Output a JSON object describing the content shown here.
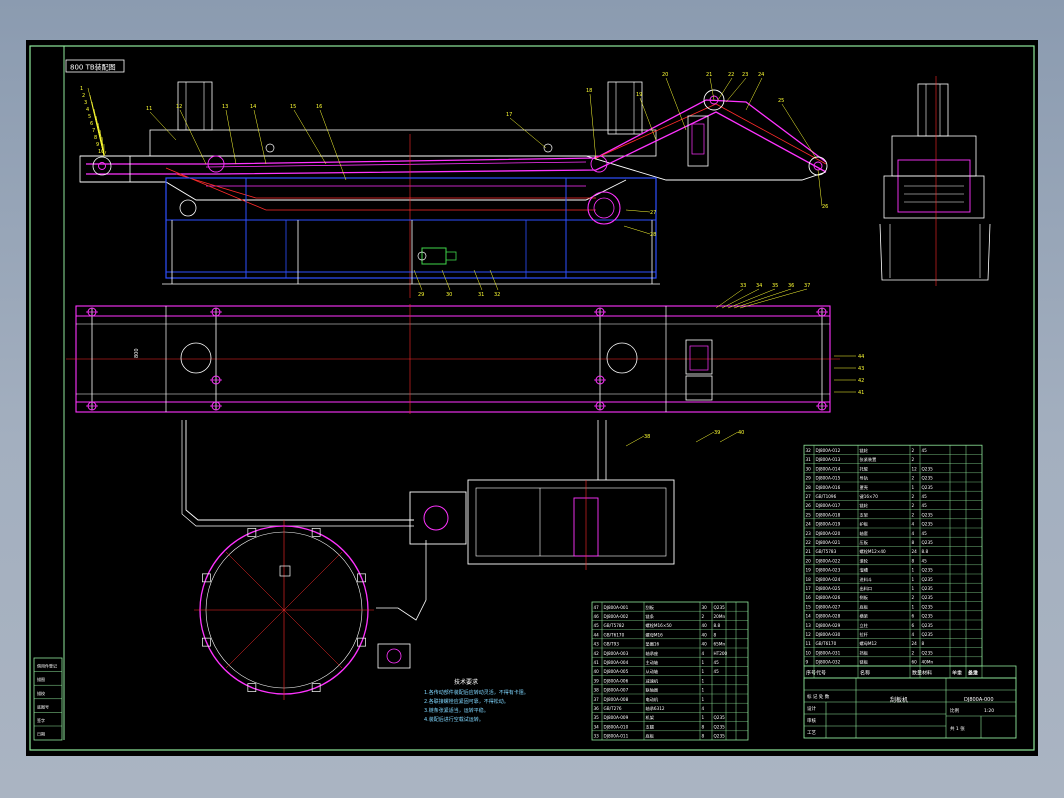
{
  "drawing": {
    "title_tag": "800 TB装配图",
    "tech_title": "技术要求",
    "tech_notes": [
      "1.各传动部件装配后应转动灵活，不得有卡阻。",
      "2.各联接螺栓应紧固可靠，不得松动。",
      "3.链条张紧适当，运转平稳。",
      "4.装配后进行空载试运转。"
    ],
    "left_labels": [
      "1",
      "2",
      "3",
      "4",
      "5",
      "6",
      "7",
      "8",
      "9",
      "10"
    ],
    "top_labels": [
      "11",
      "12",
      "13",
      "14",
      "15",
      "16",
      "17",
      "18",
      "19",
      "20",
      "21",
      "22",
      "23",
      "24",
      "25"
    ],
    "right_labels": [
      "26",
      "27",
      "28"
    ],
    "bottom_labels": [
      "29",
      "30",
      "31",
      "32"
    ],
    "plan_labels": [
      "33",
      "34",
      "35",
      "36",
      "37"
    ],
    "plan_right_labels": [
      "44",
      "43",
      "42",
      "41"
    ],
    "pipe_labels": [
      "38",
      "39",
      "40"
    ],
    "header_row": [
      "序号",
      "代号",
      "名称",
      "数量",
      "材料",
      "单重",
      "总重",
      "备注"
    ],
    "part_rows_left": [
      [
        "47",
        "DJ800A-001",
        "刮板",
        "30",
        "Q235",
        "",
        ""
      ],
      [
        "46",
        "DJ800A-002",
        "链条",
        "2",
        "20Mn",
        "",
        ""
      ],
      [
        "45",
        "GB/T5782",
        "螺栓M16×50",
        "40",
        "8.8",
        "",
        ""
      ],
      [
        "44",
        "GB/T6170",
        "螺母M16",
        "40",
        "8",
        "",
        ""
      ],
      [
        "43",
        "GB/T93",
        "垫圈16",
        "40",
        "65Mn",
        "",
        ""
      ],
      [
        "42",
        "DJ800A-003",
        "轴承座",
        "4",
        "HT200",
        "",
        ""
      ],
      [
        "41",
        "DJ800A-004",
        "主动轴",
        "1",
        "45",
        "",
        ""
      ],
      [
        "40",
        "DJ800A-005",
        "从动轴",
        "1",
        "45",
        "",
        ""
      ],
      [
        "39",
        "DJ800A-006",
        "减速机",
        "1",
        "",
        "",
        ""
      ],
      [
        "38",
        "DJ800A-007",
        "联轴器",
        "1",
        "",
        "",
        ""
      ],
      [
        "37",
        "DJ800A-008",
        "电动机",
        "1",
        "",
        "",
        ""
      ],
      [
        "36",
        "GB/T276",
        "轴承6312",
        "4",
        "",
        "",
        ""
      ],
      [
        "35",
        "DJ800A-009",
        "机架",
        "1",
        "Q235",
        "",
        ""
      ],
      [
        "34",
        "DJ800A-010",
        "支腿",
        "8",
        "Q235",
        "",
        ""
      ],
      [
        "33",
        "DJ800A-011",
        "底板",
        "8",
        "Q235",
        "",
        ""
      ]
    ],
    "part_rows_right": [
      [
        "32",
        "DJ800A-012",
        "链轮",
        "2",
        "45",
        "",
        ""
      ],
      [
        "31",
        "DJ800A-013",
        "张紧装置",
        "2",
        "",
        "",
        ""
      ],
      [
        "30",
        "DJ800A-014",
        "托辊",
        "12",
        "Q235",
        "",
        ""
      ],
      [
        "29",
        "DJ800A-015",
        "导轨",
        "2",
        "Q235",
        "",
        ""
      ],
      [
        "28",
        "DJ800A-016",
        "罩壳",
        "1",
        "Q235",
        "",
        ""
      ],
      [
        "27",
        "GB/T1096",
        "键16×70",
        "2",
        "45",
        "",
        ""
      ],
      [
        "26",
        "DJ800A-017",
        "链轮",
        "2",
        "45",
        "",
        ""
      ],
      [
        "25",
        "DJ800A-018",
        "支架",
        "2",
        "Q235",
        "",
        ""
      ],
      [
        "24",
        "DJ800A-019",
        "护板",
        "4",
        "Q235",
        "",
        ""
      ],
      [
        "23",
        "DJ800A-020",
        "轴套",
        "4",
        "45",
        "",
        ""
      ],
      [
        "22",
        "DJ800A-021",
        "压板",
        "8",
        "Q235",
        "",
        ""
      ],
      [
        "21",
        "GB/T5783",
        "螺栓M12×40",
        "24",
        "8.8",
        "",
        ""
      ],
      [
        "20",
        "DJ800A-022",
        "滚轮",
        "8",
        "45",
        "",
        ""
      ],
      [
        "19",
        "DJ800A-023",
        "溜槽",
        "1",
        "Q235",
        "",
        ""
      ],
      [
        "18",
        "DJ800A-024",
        "进料斗",
        "1",
        "Q235",
        "",
        ""
      ],
      [
        "17",
        "DJ800A-025",
        "出料口",
        "1",
        "Q235",
        "",
        ""
      ],
      [
        "16",
        "DJ800A-026",
        "侧板",
        "2",
        "Q235",
        "",
        ""
      ],
      [
        "15",
        "DJ800A-027",
        "底板",
        "1",
        "Q235",
        "",
        ""
      ],
      [
        "14",
        "DJ800A-028",
        "横梁",
        "6",
        "Q235",
        "",
        ""
      ],
      [
        "13",
        "DJ800A-029",
        "立柱",
        "6",
        "Q235",
        "",
        ""
      ],
      [
        "12",
        "DJ800A-030",
        "拉杆",
        "4",
        "Q235",
        "",
        ""
      ],
      [
        "11",
        "GB/T6170",
        "螺母M12",
        "24",
        "8",
        "",
        ""
      ],
      [
        "10",
        "DJ800A-031",
        "挡板",
        "2",
        "Q235",
        "",
        ""
      ],
      [
        "9",
        "DJ800A-032",
        "链板",
        "60",
        "40Mn",
        "",
        ""
      ]
    ],
    "title_block": {
      "drawing_name": "刮板机",
      "drawing_no": "DJ800A-000",
      "scale_label": "比例",
      "scale": "1:20",
      "sheet_label": "共 1 张",
      "sign_rows": [
        "设计",
        "审核",
        "工艺",
        "批准"
      ],
      "stage_marks": "标 记 处 数"
    },
    "sidebar_cells": [
      "借用件登记",
      "描图",
      "描校",
      "底图号",
      "签字",
      "日期"
    ]
  }
}
